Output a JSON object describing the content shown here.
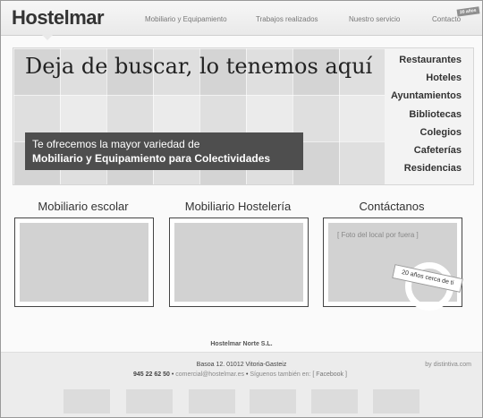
{
  "header": {
    "logo": "Hostelmar",
    "nav": [
      "Mobiliario y Equipamiento",
      "Trabajos realizados",
      "Nuestro servicio",
      "Contacto"
    ],
    "badge": "20 años"
  },
  "hero": {
    "title": "Deja de buscar, lo tenemos aquí",
    "box_line1": "Te ofrecemos la mayor variedad de",
    "box_line2": "Mobiliario y Equipamiento para Colectividades",
    "sectors": [
      "Restaurantes",
      "Hoteles",
      "Ayuntamientos",
      "Bibliotecas",
      "Colegios",
      "Cafeterías",
      "Residencias"
    ]
  },
  "columns": [
    {
      "title": "Mobiliario escolar"
    },
    {
      "title": "Mobiliario Hostelería"
    },
    {
      "title": "Contáctanos",
      "placeholder": "[ Foto del local por fuera ]",
      "ribbon": "20 años cerca de ti"
    }
  ],
  "footer": {
    "company": "Hostelmar Norte S.L.",
    "address": "Basoa 12. 01012 Vitoria-Gasteiz",
    "phone": "945 22 62 50",
    "bullet": "•",
    "email": "comercial@hostelmar.es",
    "follow_label": "Síguenos también en:",
    "facebook": "[ Facebook ]",
    "credit": "by distintiva.com"
  },
  "colors": {
    "hero_box": "#4e4e4e",
    "placeholder": "#d2d2d2",
    "footer": "#ececec"
  }
}
